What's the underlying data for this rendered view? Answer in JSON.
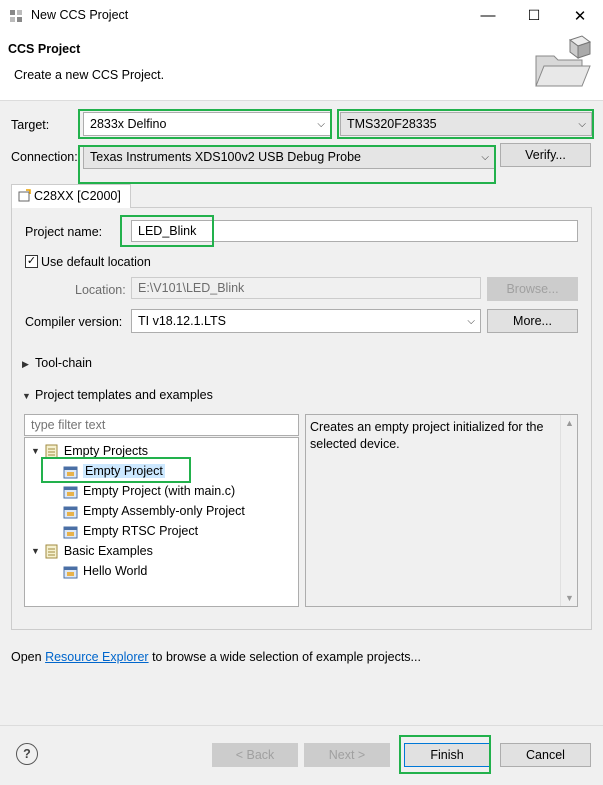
{
  "window": {
    "title": "New CCS Project",
    "minimize": "—",
    "maximize": "☐",
    "close": "✕"
  },
  "header": {
    "title": "CCS Project",
    "subtitle": "Create a new CCS Project."
  },
  "target": {
    "label": "Target:",
    "family": "2833x Delfino",
    "device": "TMS320F28335"
  },
  "connection": {
    "label": "Connection:",
    "value": "Texas Instruments XDS100v2 USB Debug Probe",
    "verify": "Verify..."
  },
  "tab": {
    "label": "C28XX [C2000]"
  },
  "project": {
    "name_label": "Project name:",
    "name_value": "LED_Blink",
    "use_default_label": "Use default location",
    "use_default_checked": true,
    "location_label": "Location:",
    "location_value": "E:\\V101\\LED_Blink",
    "browse": "Browse...",
    "compiler_label": "Compiler version:",
    "compiler_value": "TI v18.12.1.LTS",
    "more": "More..."
  },
  "sections": {
    "toolchain": "Tool-chain",
    "templates": "Project templates and examples"
  },
  "filter": {
    "placeholder": "type filter text"
  },
  "tree": {
    "groups": [
      {
        "label": "Empty Projects",
        "items": [
          "Empty Project",
          "Empty Project (with main.c)",
          "Empty Assembly-only Project",
          "Empty RTSC Project"
        ]
      },
      {
        "label": "Basic Examples",
        "items": [
          "Hello World"
        ]
      }
    ],
    "selected": "Empty Project"
  },
  "description": "Creates an empty project initialized for the selected device.",
  "footer": {
    "open_prefix": "Open",
    "resource_explorer": "Resource Explorer",
    "open_suffix": "to browse a wide selection of example projects...",
    "help": "?",
    "back": "< Back",
    "next": "Next >",
    "finish": "Finish",
    "cancel": "Cancel"
  },
  "colors": {
    "highlight": "#22b14c",
    "selection": "#cce8ff",
    "link": "#0066cc"
  }
}
